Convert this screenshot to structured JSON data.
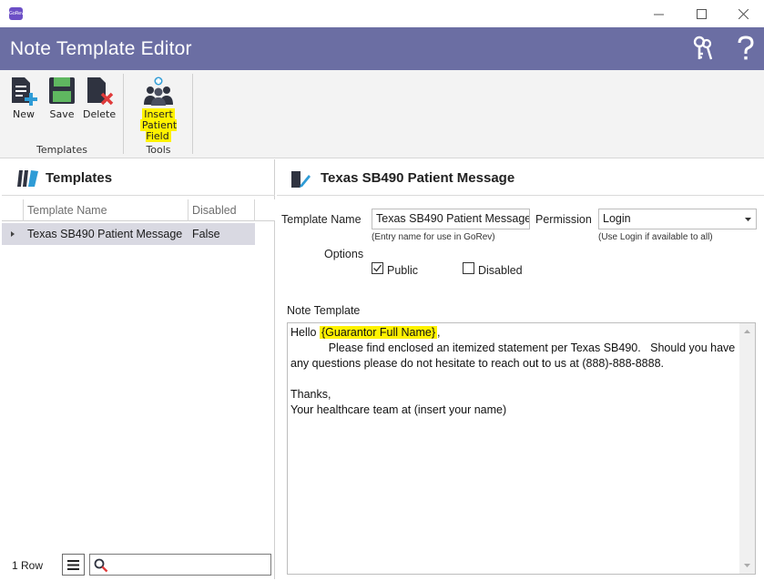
{
  "window": {
    "app_icon_label": "GoRev",
    "title": "Note Template Editor"
  },
  "ribbon": {
    "groups": [
      {
        "label": "Templates"
      },
      {
        "label": "Tools"
      }
    ],
    "buttons": {
      "new": "New",
      "save": "Save",
      "delete": "Delete",
      "insert_line1": "Insert",
      "insert_line2": "Patient Field"
    }
  },
  "templates_panel": {
    "title": "Templates",
    "columns": [
      "Template Name",
      "Disabled"
    ],
    "rows": [
      {
        "name": "Texas SB490 Patient Message",
        "disabled": "False"
      }
    ],
    "row_count": "1 Row",
    "search_value": ""
  },
  "detail_panel": {
    "title": "Texas SB490 Patient Message",
    "template_name_label": "Template Name",
    "template_name_value": "Texas SB490 Patient Message",
    "template_name_hint": "(Entry name for use in GoRev)",
    "permission_label": "Permission",
    "permission_value": "Login",
    "permission_hint": "(Use Login if available to all)",
    "options_label": "Options",
    "public_label": "Public",
    "public_checked": true,
    "disabled_label": "Disabled",
    "disabled_checked": false,
    "note_template_label": "Note Template",
    "note": {
      "greeting": "Hello ",
      "field": "{Guarantor Full Name}",
      "after_field": ",",
      "line2": "            Please find enclosed an itemized statement per Texas SB490.   Should you have any questions please do not hesitate to reach out to us at (888)-888-8888.",
      "line3": "",
      "line4": "Thanks,",
      "line5": "Your healthcare team at (insert your name)"
    }
  },
  "colors": {
    "header_bg": "#6b6ea3",
    "highlight": "#fff200",
    "selected_row": "#d9d9e2"
  }
}
